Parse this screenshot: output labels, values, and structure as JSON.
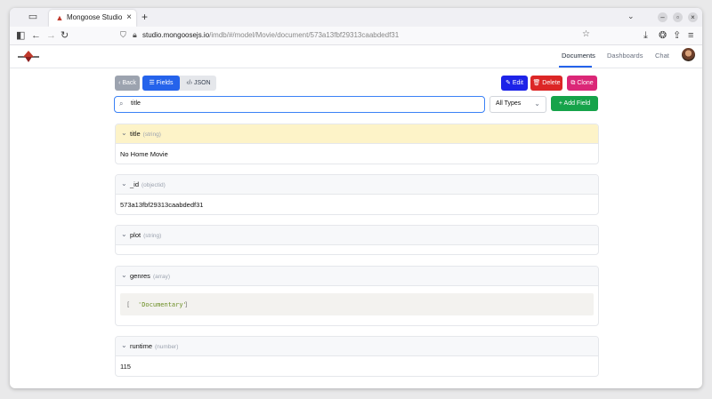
{
  "browser": {
    "tab_title": "Mongoose Studio",
    "url_domain": "studio.mongoosejs.io",
    "url_path": "/imdb/#/model/Movie/document/573a13fbf29313caabdedf31"
  },
  "header": {
    "nav": [
      "Documents",
      "Dashboards",
      "Chat"
    ],
    "active": "Documents"
  },
  "toolbar": {
    "back_label": "‹ Back",
    "fields_label": "Fields",
    "json_label": "JSON",
    "edit_label": "Edit",
    "delete_label": "Delete",
    "clone_label": "Clone",
    "search_value": "title",
    "type_filter": "All Types",
    "add_field_label": "Add Field"
  },
  "fields": [
    {
      "name": "title",
      "type": "(string)",
      "value": "No Home Movie"
    },
    {
      "name": "_id",
      "type": "(objectid)",
      "value": "573a13fbf29313caabdedf31"
    },
    {
      "name": "plot",
      "type": "(string)",
      "value": ""
    },
    {
      "name": "genres",
      "type": "(array)",
      "code_open": "[",
      "code_value": "'Documentary'",
      "code_close": "]"
    },
    {
      "name": "runtime",
      "type": "(number)",
      "value": "115"
    }
  ],
  "colors": {
    "primary": "#2563eb",
    "edit": "#1d23e8",
    "delete": "#dc2626",
    "clone": "#db2777",
    "add": "#16a34a",
    "highlight": "#fdf3c8",
    "string_literal": "#6b8e23"
  }
}
